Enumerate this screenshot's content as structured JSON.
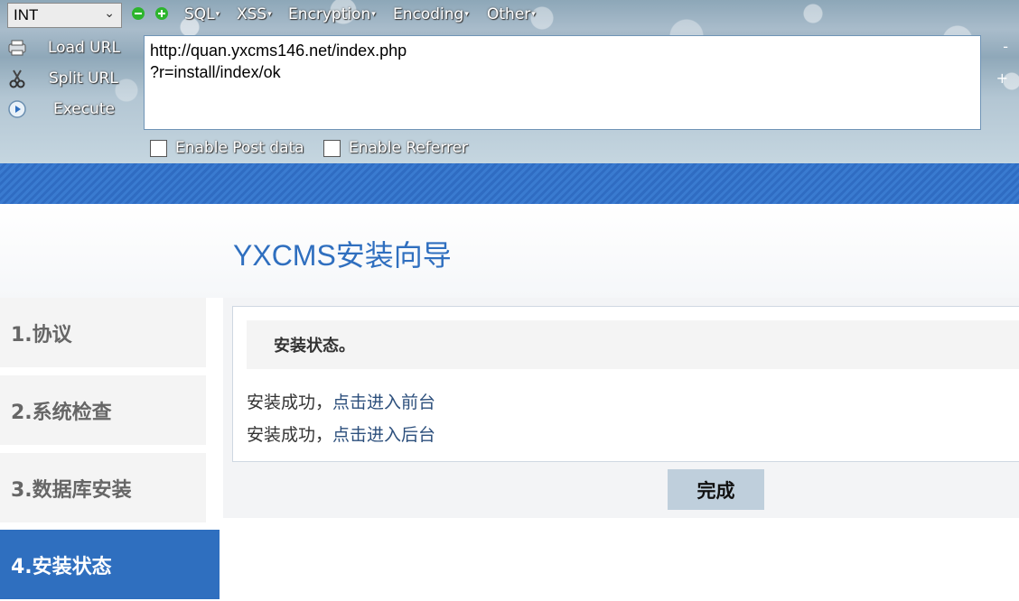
{
  "hackbar": {
    "type_select": "INT",
    "menus": [
      "SQL",
      "XSS",
      "Encryption",
      "Encoding",
      "Other"
    ],
    "actions": {
      "load_url": "Load URL",
      "split_url": "Split URL",
      "execute": "Execute"
    },
    "url_value": "http://quan.yxcms146.net/index.php\n?r=install/index/ok",
    "minus_glyph": "-",
    "plus_glyph": "+",
    "enable_post": "Enable Post data",
    "enable_referrer": "Enable Referrer"
  },
  "page": {
    "title": "YXCMS安装向导",
    "steps": [
      {
        "label": "1.协议",
        "active": false
      },
      {
        "label": "2.系统检查",
        "active": false
      },
      {
        "label": "3.数据库安装",
        "active": false
      },
      {
        "label": "4.安装状态",
        "active": true
      }
    ],
    "status_heading": "安装状态。",
    "messages": [
      {
        "prefix": "安装成功，",
        "link": "点击进入前台"
      },
      {
        "prefix": "安装成功，",
        "link": "点击进入后台"
      }
    ],
    "done_button": "完成"
  },
  "colors": {
    "accent": "#2f6fbf",
    "link": "#2c4f7c",
    "banner": "#3a7bd0"
  }
}
